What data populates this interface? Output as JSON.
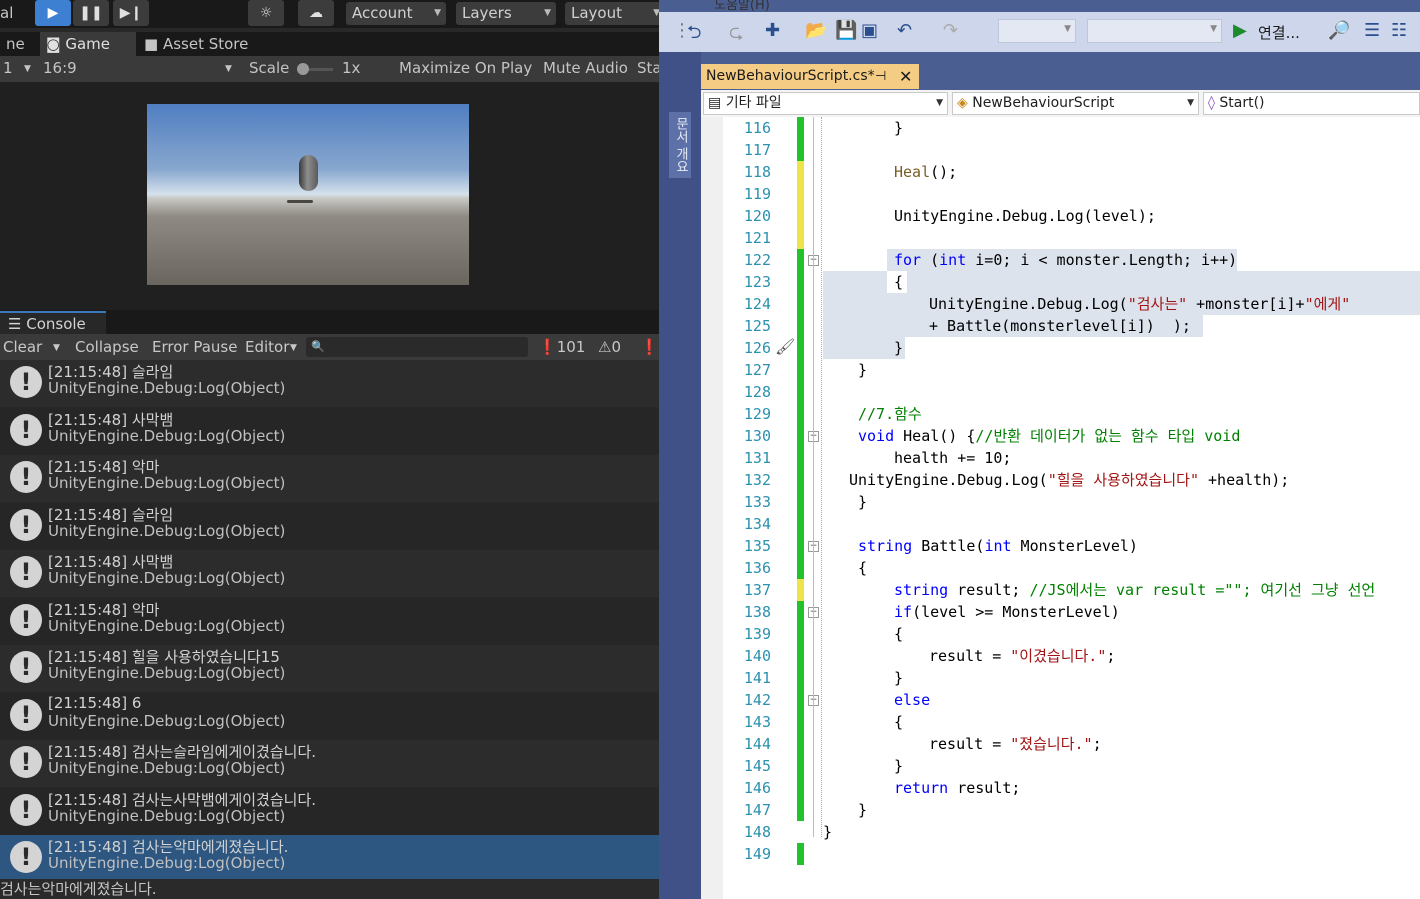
{
  "unity": {
    "toolbar": {
      "left_text": "al",
      "play_icon": "play-icon",
      "pause_icon": "pause-icon",
      "step_icon": "step-icon",
      "collab_icon": "collab-icon",
      "cloud_icon": "cloud-icon",
      "account": "Account",
      "layers": "Layers",
      "layout": "Layout"
    },
    "tabs": {
      "scene_partial": "ne",
      "game": "Game",
      "asset_store": "Asset Store"
    },
    "game_bar": {
      "display_partial": "1",
      "aspect": "16:9",
      "scale_label": "Scale",
      "scale_value": "1x",
      "maximize": "Maximize On Play",
      "mute": "Mute Audio",
      "stats_partial": "Sta"
    },
    "console": {
      "tab": "Console",
      "clear": "Clear",
      "collapse": "Collapse",
      "error_pause": "Error Pause",
      "editor": "Editor",
      "search_placeholder": "",
      "log_count": "101",
      "warn_count": "0",
      "entries": [
        {
          "time": "[21:15:48] 슬라임",
          "src": "UnityEngine.Debug:Log(Object)"
        },
        {
          "time": "[21:15:48] 사막뱀",
          "src": "UnityEngine.Debug:Log(Object)"
        },
        {
          "time": "[21:15:48] 악마",
          "src": "UnityEngine.Debug:Log(Object)"
        },
        {
          "time": "[21:15:48] 슬라임",
          "src": "UnityEngine.Debug:Log(Object)"
        },
        {
          "time": "[21:15:48] 사막뱀",
          "src": "UnityEngine.Debug:Log(Object)"
        },
        {
          "time": "[21:15:48] 악마",
          "src": "UnityEngine.Debug:Log(Object)"
        },
        {
          "time": "[21:15:48] 힐을 사용하였습니다15",
          "src": "UnityEngine.Debug:Log(Object)"
        },
        {
          "time": "[21:15:48] 6",
          "src": "UnityEngine.Debug:Log(Object)"
        },
        {
          "time": "[21:15:48] 검사는슬라임에게이겼습니다.",
          "src": "UnityEngine.Debug:Log(Object)"
        },
        {
          "time": "[21:15:48] 검사는사막뱀에게이겼습니다.",
          "src": "UnityEngine.Debug:Log(Object)"
        },
        {
          "time": "[21:15:48] 검사는악마에게졌습니다.",
          "src": "UnityEngine.Debug:Log(Object)"
        }
      ],
      "status": "검사는악마에게졌습니다."
    }
  },
  "vs": {
    "menu_partial": "도움말(H)",
    "attach_label": "연결...",
    "side_tab": "문서 개요",
    "doc_tab": "NewBehaviourScript.cs*",
    "nav": {
      "project": "기타 파일",
      "class": "NewBehaviourScript",
      "member": "Start()"
    },
    "line_numbers": [
      "116",
      "117",
      "118",
      "119",
      "120",
      "121",
      "122",
      "123",
      "124",
      "125",
      "126",
      "127",
      "128",
      "129",
      "130",
      "131",
      "132",
      "133",
      "134",
      "135",
      "136",
      "137",
      "138",
      "139",
      "140",
      "141",
      "142",
      "143",
      "144",
      "145",
      "146",
      "147",
      "148",
      "149"
    ],
    "code": {
      "l116": "}",
      "l118_fn": "Heal",
      "l118_rest": "();",
      "l120": "UnityEngine.Debug.Log(level);",
      "l122_for": "for",
      "l122_a": " (",
      "l122_int": "int",
      "l122_b": " i=0; i < monster.Length; i++)",
      "l123": "{",
      "l124_a": "UnityEngine.Debug.Log(",
      "l124_s1": "\"검사는\"",
      "l124_b": " +monster[i]+",
      "l124_s2": "\"에게\"",
      "l125": "+ Battle(monsterlevel[i])  );",
      "l126": "}",
      "l127": "}",
      "l129": "//7.함수",
      "l130_void": "void",
      "l130_a": " Heal() {",
      "l130_cmt": "//반환 데이터가 없는 함수 타입 void",
      "l131": "health += 10;",
      "l132_a": "UnityEngine.Debug.Log(",
      "l132_s": "\"힐을 사용하였습니다\"",
      "l132_b": " +health);",
      "l133": "}",
      "l135_kw": "string",
      "l135_a": " Battle(",
      "l135_int": "int",
      "l135_b": " MonsterLevel)",
      "l136": "{",
      "l137_kw": "string",
      "l137_a": " result; ",
      "l137_cmt": "//JS에서는 var result =\"\"; 여기선 그냥 선언",
      "l138_if": "if",
      "l138_a": "(level >= MonsterLevel)",
      "l139": "{",
      "l140_a": "result = ",
      "l140_s": "\"이겼습니다.\"",
      "l140_b": ";",
      "l141": "}",
      "l142": "else",
      "l143": "{",
      "l144_a": "result = ",
      "l144_s": "\"졌습니다.\"",
      "l144_b": ";",
      "l145": "}",
      "l146_kw": "return",
      "l146_a": " result;",
      "l147": "}",
      "l148": "}"
    }
  },
  "colors": {
    "play_accent": "#3d7fd0",
    "console_selected": "#2d5680",
    "vs_tab": "#f5cc84",
    "keyword": "#0000ff",
    "string": "#a31515",
    "comment": "#008000",
    "change_saved": "#22c22e",
    "change_unsaved": "#efe34a"
  }
}
